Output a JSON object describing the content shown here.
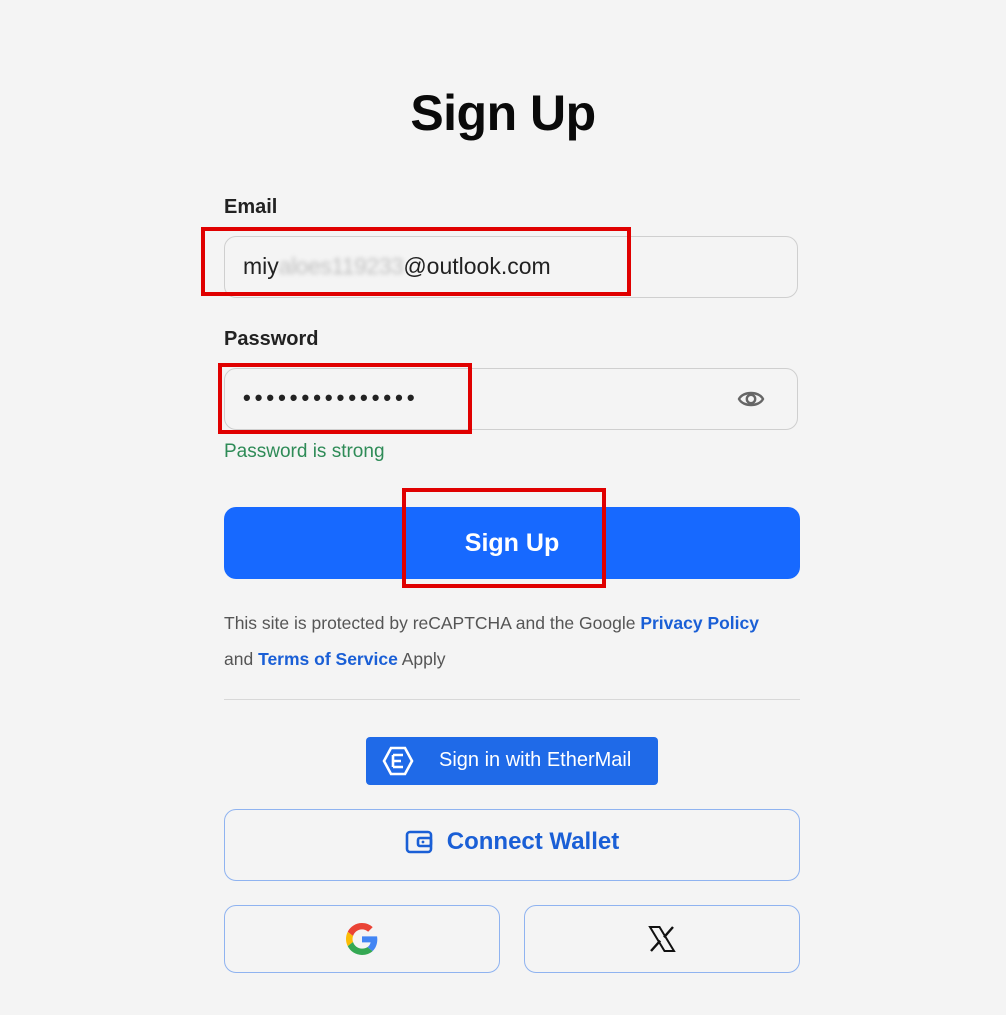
{
  "page": {
    "title": "Sign Up"
  },
  "form": {
    "email_label": "Email",
    "email_value_prefix": "miy",
    "email_value_redacted": "aloes119233",
    "email_value_suffix": "@outlook.com",
    "password_label": "Password",
    "password_value_masked": "•••••••••••••••",
    "password_toggle_icon": "eye-icon",
    "password_strength": "Password is strong",
    "password_strength_color": "#2e8b57",
    "submit_label": "Sign Up"
  },
  "legal": {
    "text_before": "This site is protected by reCAPTCHA and the Google ",
    "privacy_link": "Privacy Policy",
    "text_and": "and ",
    "terms_link": "Terms of Service",
    "text_after": " Apply"
  },
  "alt_auth": {
    "ethermail_label": "Sign in with EtherMail",
    "ethermail_icon": "ethermail-logo-icon",
    "connect_wallet_label": "Connect Wallet",
    "connect_wallet_icon": "wallet-icon",
    "google_icon": "google-logo-icon",
    "x_icon": "x-logo-icon"
  },
  "colors": {
    "primary": "#1769ff",
    "link": "#1a5fd6",
    "annotation": "#e00000",
    "background": "#f4f4f4"
  }
}
